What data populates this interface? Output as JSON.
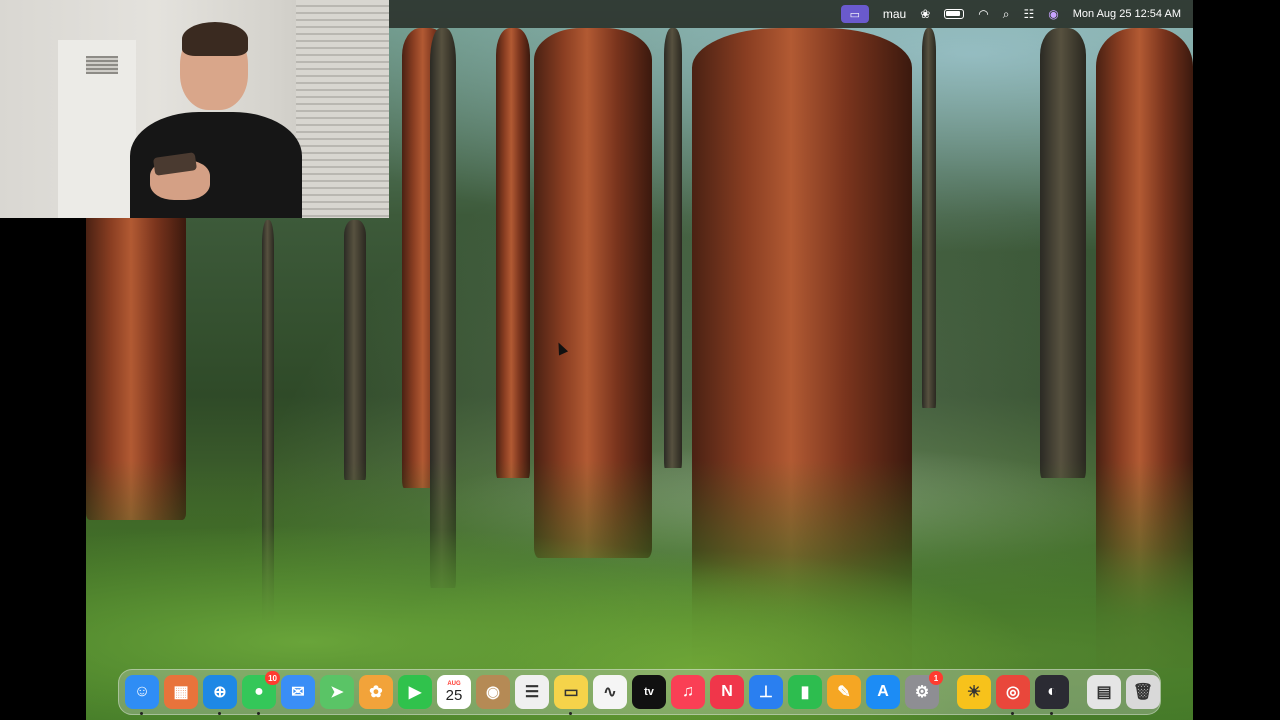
{
  "menubar": {
    "user": "mau",
    "clock": "Mon Aug 25  12:54 AM",
    "icons": [
      "screen-record-icon",
      "paw-icon",
      "battery-icon",
      "wifi-icon",
      "search-icon",
      "control-center-icon",
      "siri-icon"
    ]
  },
  "desktop": {
    "wallpaper": "redwood-forest"
  },
  "webcam": {
    "subject": "person-with-phone"
  },
  "dock": {
    "items": [
      {
        "name": "finder",
        "glyph": "☺",
        "color": "#2f8df5",
        "running": true
      },
      {
        "name": "launchpad",
        "glyph": "▦",
        "color": "#e8733b",
        "running": false
      },
      {
        "name": "safari",
        "glyph": "⊕",
        "color": "#1e88e5",
        "running": true
      },
      {
        "name": "messages",
        "glyph": "●",
        "color": "#34c759",
        "running": true,
        "badge": "10"
      },
      {
        "name": "mail",
        "glyph": "✉",
        "color": "#3a8ef6",
        "running": false
      },
      {
        "name": "maps",
        "glyph": "➤",
        "color": "#5ac466",
        "running": false
      },
      {
        "name": "photos",
        "glyph": "✿",
        "color": "#f2a33a",
        "running": false
      },
      {
        "name": "facetime",
        "glyph": "▶",
        "color": "#30c24c",
        "running": false
      },
      {
        "name": "calendar",
        "month": "AUG",
        "day": "25",
        "running": false
      },
      {
        "name": "contacts",
        "glyph": "◉",
        "color": "#b58a55",
        "running": false
      },
      {
        "name": "reminders",
        "glyph": "☰",
        "color": "#f0f0f0",
        "running": false
      },
      {
        "name": "notes",
        "glyph": "▭",
        "color": "#f5d34a",
        "running": true
      },
      {
        "name": "freeform",
        "glyph": "∿",
        "color": "#f5f5f5",
        "running": false
      },
      {
        "name": "tv",
        "glyph": "tv",
        "color": "#111111",
        "running": false
      },
      {
        "name": "music",
        "glyph": "♫",
        "color": "#fa3f55",
        "running": false
      },
      {
        "name": "news",
        "glyph": "N",
        "color": "#f0364a",
        "running": false
      },
      {
        "name": "keynote",
        "glyph": "⊥",
        "color": "#2a7ff0",
        "running": false
      },
      {
        "name": "numbers",
        "glyph": "▮",
        "color": "#2dbd4f",
        "running": false
      },
      {
        "name": "pages",
        "glyph": "✎",
        "color": "#f5a623",
        "running": false
      },
      {
        "name": "app-store",
        "glyph": "A",
        "color": "#1c8cf5",
        "running": false
      },
      {
        "name": "system-settings",
        "glyph": "⚙",
        "color": "#8e8e93",
        "running": false,
        "badge": "1"
      },
      {
        "name": "tips",
        "glyph": "☀",
        "color": "#f7c21b",
        "running": false
      },
      {
        "name": "chrome",
        "glyph": "◎",
        "color": "#e9473b",
        "running": true
      },
      {
        "name": "obs",
        "glyph": "◐",
        "color": "#2b2b33",
        "running": true
      },
      {
        "name": "downloads-stack",
        "glyph": "▤",
        "color": "#e5e5e5",
        "running": false
      },
      {
        "name": "trash",
        "glyph": "🗑",
        "color": "#d9d9d9",
        "running": false
      }
    ]
  }
}
